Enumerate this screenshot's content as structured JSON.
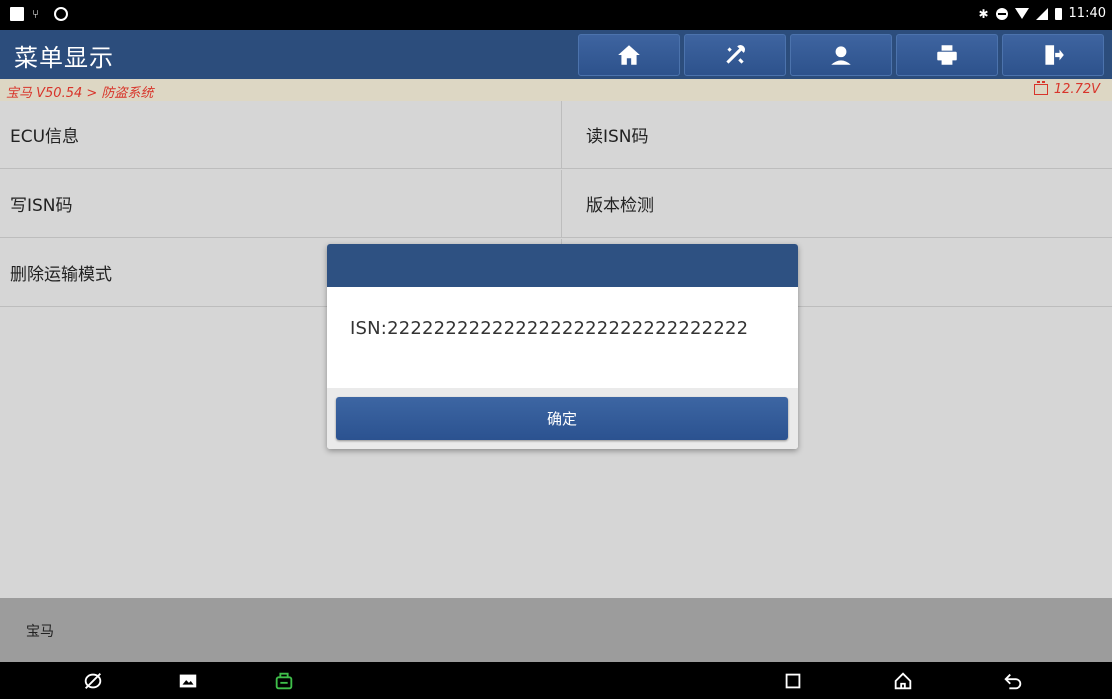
{
  "status_bar": {
    "time": "11:40"
  },
  "header": {
    "title": "菜单显示",
    "toolbar": [
      "home-icon",
      "tools-icon",
      "user-icon",
      "printer-icon",
      "exit-icon"
    ]
  },
  "breadcrumb": {
    "path": "宝马 V50.54 > 防盗系统",
    "voltage": "12.72V"
  },
  "menu": {
    "items": [
      {
        "label": "ECU信息"
      },
      {
        "label": "读ISN码"
      },
      {
        "label": "写ISN码"
      },
      {
        "label": "版本检测"
      },
      {
        "label": "删除运输模式"
      }
    ]
  },
  "footer": {
    "label": "宝马"
  },
  "dialog": {
    "message": "ISN:2222222222222222222222222222222",
    "ok_label": "确定"
  },
  "colors": {
    "titlebar": "#2c4d7c",
    "breadcrumb_text": "#d8342a",
    "dialog_button": "#2d528c"
  }
}
